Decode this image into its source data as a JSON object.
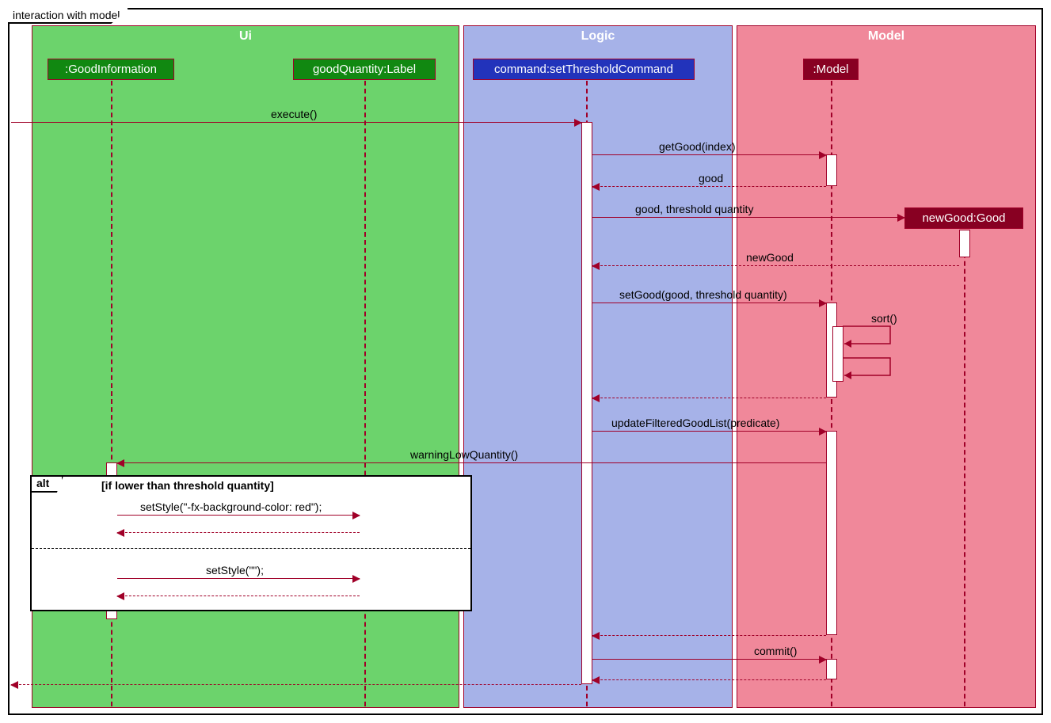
{
  "frame_title": "interaction with model",
  "regions": {
    "ui": "Ui",
    "logic": "Logic",
    "model": "Model"
  },
  "participants": {
    "good_info": ":GoodInformation",
    "good_qty": "goodQuantity:Label",
    "command": "command:setThresholdCommand",
    "model": ":Model",
    "new_good": "newGood:Good"
  },
  "messages": {
    "execute": "execute()",
    "getGood": "getGood(index)",
    "good_ret": "good",
    "good_thresh": "good, threshold quantity",
    "newGood_ret": "newGood",
    "setGood": "setGood(good, threshold quantity)",
    "sort": "sort()",
    "updateFiltered": "updateFilteredGoodList(predicate)",
    "warningLow": "warningLowQuantity()",
    "setStyleRed": "setStyle(\"-fx-background-color: red\");",
    "setStyleEmpty": "setStyle(\"\");",
    "commit": "commit()"
  },
  "alt": {
    "label": "alt",
    "guard": "[if lower than threshold quantity]"
  }
}
